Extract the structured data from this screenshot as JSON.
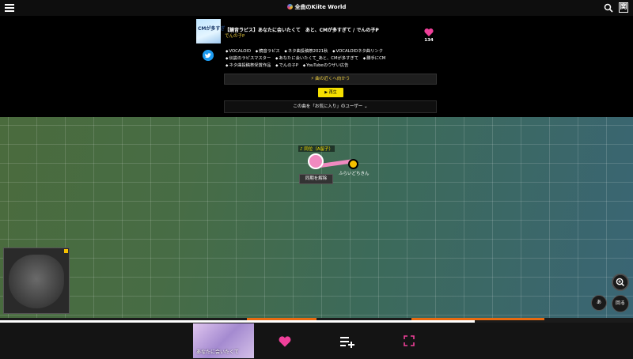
{
  "app": {
    "title": "全曲のKiite World"
  },
  "header": {
    "kanji_button": "関"
  },
  "song": {
    "thumb_text": "CMが多すぎ",
    "title": "【鏡音ラピス】あなたに会いたくて　あと、CMが多すぎて / でんの子P",
    "artist": "でんの子P",
    "like_count": "134",
    "tags": [
      "VOCALOID",
      "鏡音ラピス",
      "ネタ曲投稿祭2021秋",
      "VOCALOIDネタ曲リンク",
      "伝説のラピスマスター",
      "あなたに会いたくて_あと、CMが多すぎて",
      "勝手にCM",
      "ネタ曲投稿祭受賞作品",
      "でんの子P",
      "YouTubeのウザい広告"
    ],
    "goto_label": "⚡ 曲の近くへ向かう",
    "play_label": "▶ 再生",
    "fav_users_label": "この曲を「お気に入り」のユーザー"
  },
  "map": {
    "me_label": "♪ 同位（A留子）",
    "other_label": "ふらいどちきん",
    "unsync_label": "同期を解除",
    "a_label": "あ",
    "rotate_label": "回る"
  },
  "timeline": {
    "progress": 0.75,
    "segments": [
      {
        "start": 0.39,
        "end": 0.5,
        "color": "#e86a10"
      },
      {
        "start": 0.65,
        "end": 0.86,
        "color": "#e86a10"
      }
    ]
  },
  "player": {
    "thumb_text": "あなたに会いたくて"
  },
  "colors": {
    "accent_pink": "#f0409a",
    "accent_yellow": "#f5e000",
    "twitter": "#1d9bf0"
  }
}
